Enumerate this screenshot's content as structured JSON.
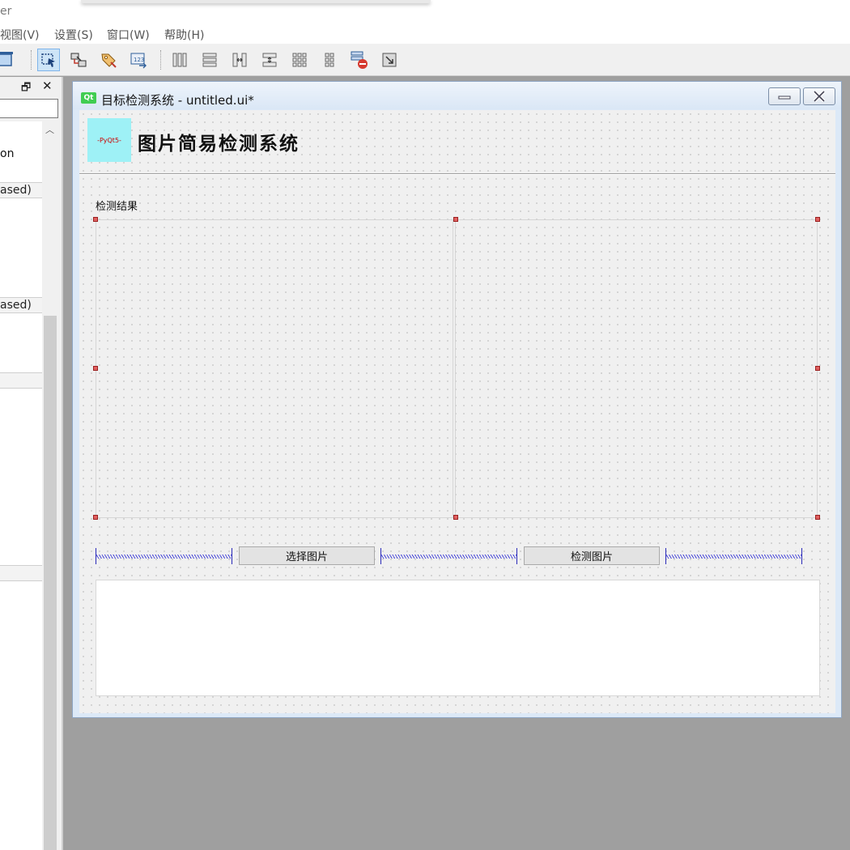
{
  "app": {
    "title_fragment": "er"
  },
  "menu": [
    {
      "label": "视图(V)"
    },
    {
      "label": "设置(S)"
    },
    {
      "label": "窗口(W)"
    },
    {
      "label": "帮助(H)"
    }
  ],
  "toolbar": {
    "icons": [
      "widget-editor-icon",
      "signal-slot-editor-icon",
      "buddy-editor-icon",
      "tab-order-editor-icon",
      "layout-horizontal-icon",
      "layout-vertical-icon",
      "layout-horizontal-splitter-icon",
      "layout-vertical-splitter-icon",
      "layout-form-icon",
      "layout-grid-icon",
      "break-layout-icon",
      "adjust-size-icon"
    ]
  },
  "widget_box": {
    "float_glyph": "🗗",
    "close_glyph": "✕",
    "scroll_up_glyph": "︿",
    "items": [
      {
        "label": "on",
        "kind": "text"
      },
      {
        "label": "ased)",
        "kind": "category"
      },
      {
        "label": "ased)",
        "kind": "category"
      },
      {
        "label": "",
        "kind": "category"
      },
      {
        "label": "",
        "kind": "category"
      }
    ]
  },
  "form": {
    "qt_logo": "Qt",
    "window_title": "目标检测系统 - untitled.ui*",
    "minimize_glyph": "—",
    "close_glyph": "✕",
    "logo_text": "-PyQt5-",
    "header_title": "图片简易检测系统",
    "result_label": "检测结果",
    "select_button": "选择图片",
    "detect_button": "检测图片",
    "log_text": ""
  },
  "colors": {
    "logo_bg": "#9ef1f6",
    "selection_handle": "#e06060",
    "spacer": "#2a2ab8",
    "toolbar_active": "#cde4f7"
  }
}
